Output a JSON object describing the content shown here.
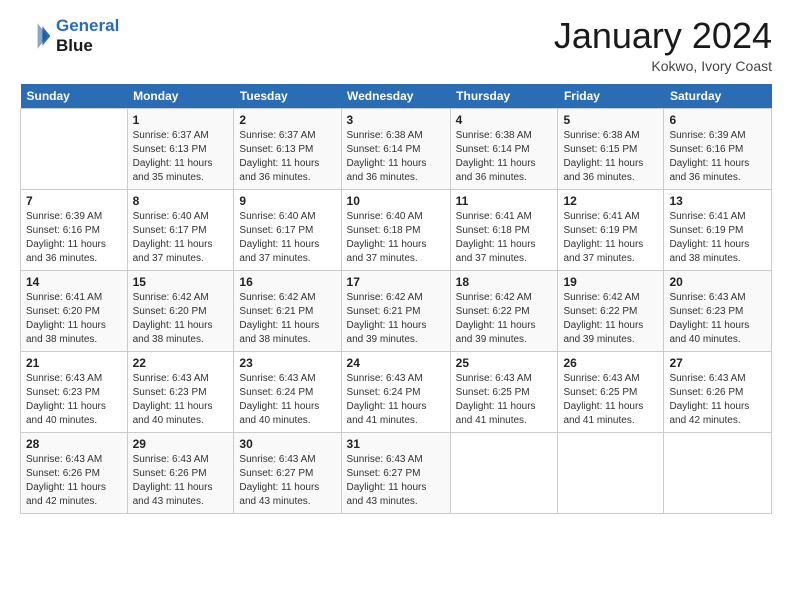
{
  "logo": {
    "line1": "General",
    "line2": "Blue"
  },
  "calendar": {
    "title": "January 2024",
    "subtitle": "Kokwo, Ivory Coast"
  },
  "header_days": [
    "Sunday",
    "Monday",
    "Tuesday",
    "Wednesday",
    "Thursday",
    "Friday",
    "Saturday"
  ],
  "weeks": [
    [
      {
        "day": "",
        "content": ""
      },
      {
        "day": "1",
        "content": "Sunrise: 6:37 AM\nSunset: 6:13 PM\nDaylight: 11 hours\nand 35 minutes."
      },
      {
        "day": "2",
        "content": "Sunrise: 6:37 AM\nSunset: 6:13 PM\nDaylight: 11 hours\nand 36 minutes."
      },
      {
        "day": "3",
        "content": "Sunrise: 6:38 AM\nSunset: 6:14 PM\nDaylight: 11 hours\nand 36 minutes."
      },
      {
        "day": "4",
        "content": "Sunrise: 6:38 AM\nSunset: 6:14 PM\nDaylight: 11 hours\nand 36 minutes."
      },
      {
        "day": "5",
        "content": "Sunrise: 6:38 AM\nSunset: 6:15 PM\nDaylight: 11 hours\nand 36 minutes."
      },
      {
        "day": "6",
        "content": "Sunrise: 6:39 AM\nSunset: 6:16 PM\nDaylight: 11 hours\nand 36 minutes."
      }
    ],
    [
      {
        "day": "7",
        "content": "Sunrise: 6:39 AM\nSunset: 6:16 PM\nDaylight: 11 hours\nand 36 minutes."
      },
      {
        "day": "8",
        "content": "Sunrise: 6:40 AM\nSunset: 6:17 PM\nDaylight: 11 hours\nand 37 minutes."
      },
      {
        "day": "9",
        "content": "Sunrise: 6:40 AM\nSunset: 6:17 PM\nDaylight: 11 hours\nand 37 minutes."
      },
      {
        "day": "10",
        "content": "Sunrise: 6:40 AM\nSunset: 6:18 PM\nDaylight: 11 hours\nand 37 minutes."
      },
      {
        "day": "11",
        "content": "Sunrise: 6:41 AM\nSunset: 6:18 PM\nDaylight: 11 hours\nand 37 minutes."
      },
      {
        "day": "12",
        "content": "Sunrise: 6:41 AM\nSunset: 6:19 PM\nDaylight: 11 hours\nand 37 minutes."
      },
      {
        "day": "13",
        "content": "Sunrise: 6:41 AM\nSunset: 6:19 PM\nDaylight: 11 hours\nand 38 minutes."
      }
    ],
    [
      {
        "day": "14",
        "content": "Sunrise: 6:41 AM\nSunset: 6:20 PM\nDaylight: 11 hours\nand 38 minutes."
      },
      {
        "day": "15",
        "content": "Sunrise: 6:42 AM\nSunset: 6:20 PM\nDaylight: 11 hours\nand 38 minutes."
      },
      {
        "day": "16",
        "content": "Sunrise: 6:42 AM\nSunset: 6:21 PM\nDaylight: 11 hours\nand 38 minutes."
      },
      {
        "day": "17",
        "content": "Sunrise: 6:42 AM\nSunset: 6:21 PM\nDaylight: 11 hours\nand 39 minutes."
      },
      {
        "day": "18",
        "content": "Sunrise: 6:42 AM\nSunset: 6:22 PM\nDaylight: 11 hours\nand 39 minutes."
      },
      {
        "day": "19",
        "content": "Sunrise: 6:42 AM\nSunset: 6:22 PM\nDaylight: 11 hours\nand 39 minutes."
      },
      {
        "day": "20",
        "content": "Sunrise: 6:43 AM\nSunset: 6:23 PM\nDaylight: 11 hours\nand 40 minutes."
      }
    ],
    [
      {
        "day": "21",
        "content": "Sunrise: 6:43 AM\nSunset: 6:23 PM\nDaylight: 11 hours\nand 40 minutes."
      },
      {
        "day": "22",
        "content": "Sunrise: 6:43 AM\nSunset: 6:23 PM\nDaylight: 11 hours\nand 40 minutes."
      },
      {
        "day": "23",
        "content": "Sunrise: 6:43 AM\nSunset: 6:24 PM\nDaylight: 11 hours\nand 40 minutes."
      },
      {
        "day": "24",
        "content": "Sunrise: 6:43 AM\nSunset: 6:24 PM\nDaylight: 11 hours\nand 41 minutes."
      },
      {
        "day": "25",
        "content": "Sunrise: 6:43 AM\nSunset: 6:25 PM\nDaylight: 11 hours\nand 41 minutes."
      },
      {
        "day": "26",
        "content": "Sunrise: 6:43 AM\nSunset: 6:25 PM\nDaylight: 11 hours\nand 41 minutes."
      },
      {
        "day": "27",
        "content": "Sunrise: 6:43 AM\nSunset: 6:26 PM\nDaylight: 11 hours\nand 42 minutes."
      }
    ],
    [
      {
        "day": "28",
        "content": "Sunrise: 6:43 AM\nSunset: 6:26 PM\nDaylight: 11 hours\nand 42 minutes."
      },
      {
        "day": "29",
        "content": "Sunrise: 6:43 AM\nSunset: 6:26 PM\nDaylight: 11 hours\nand 43 minutes."
      },
      {
        "day": "30",
        "content": "Sunrise: 6:43 AM\nSunset: 6:27 PM\nDaylight: 11 hours\nand 43 minutes."
      },
      {
        "day": "31",
        "content": "Sunrise: 6:43 AM\nSunset: 6:27 PM\nDaylight: 11 hours\nand 43 minutes."
      },
      {
        "day": "",
        "content": ""
      },
      {
        "day": "",
        "content": ""
      },
      {
        "day": "",
        "content": ""
      }
    ]
  ]
}
